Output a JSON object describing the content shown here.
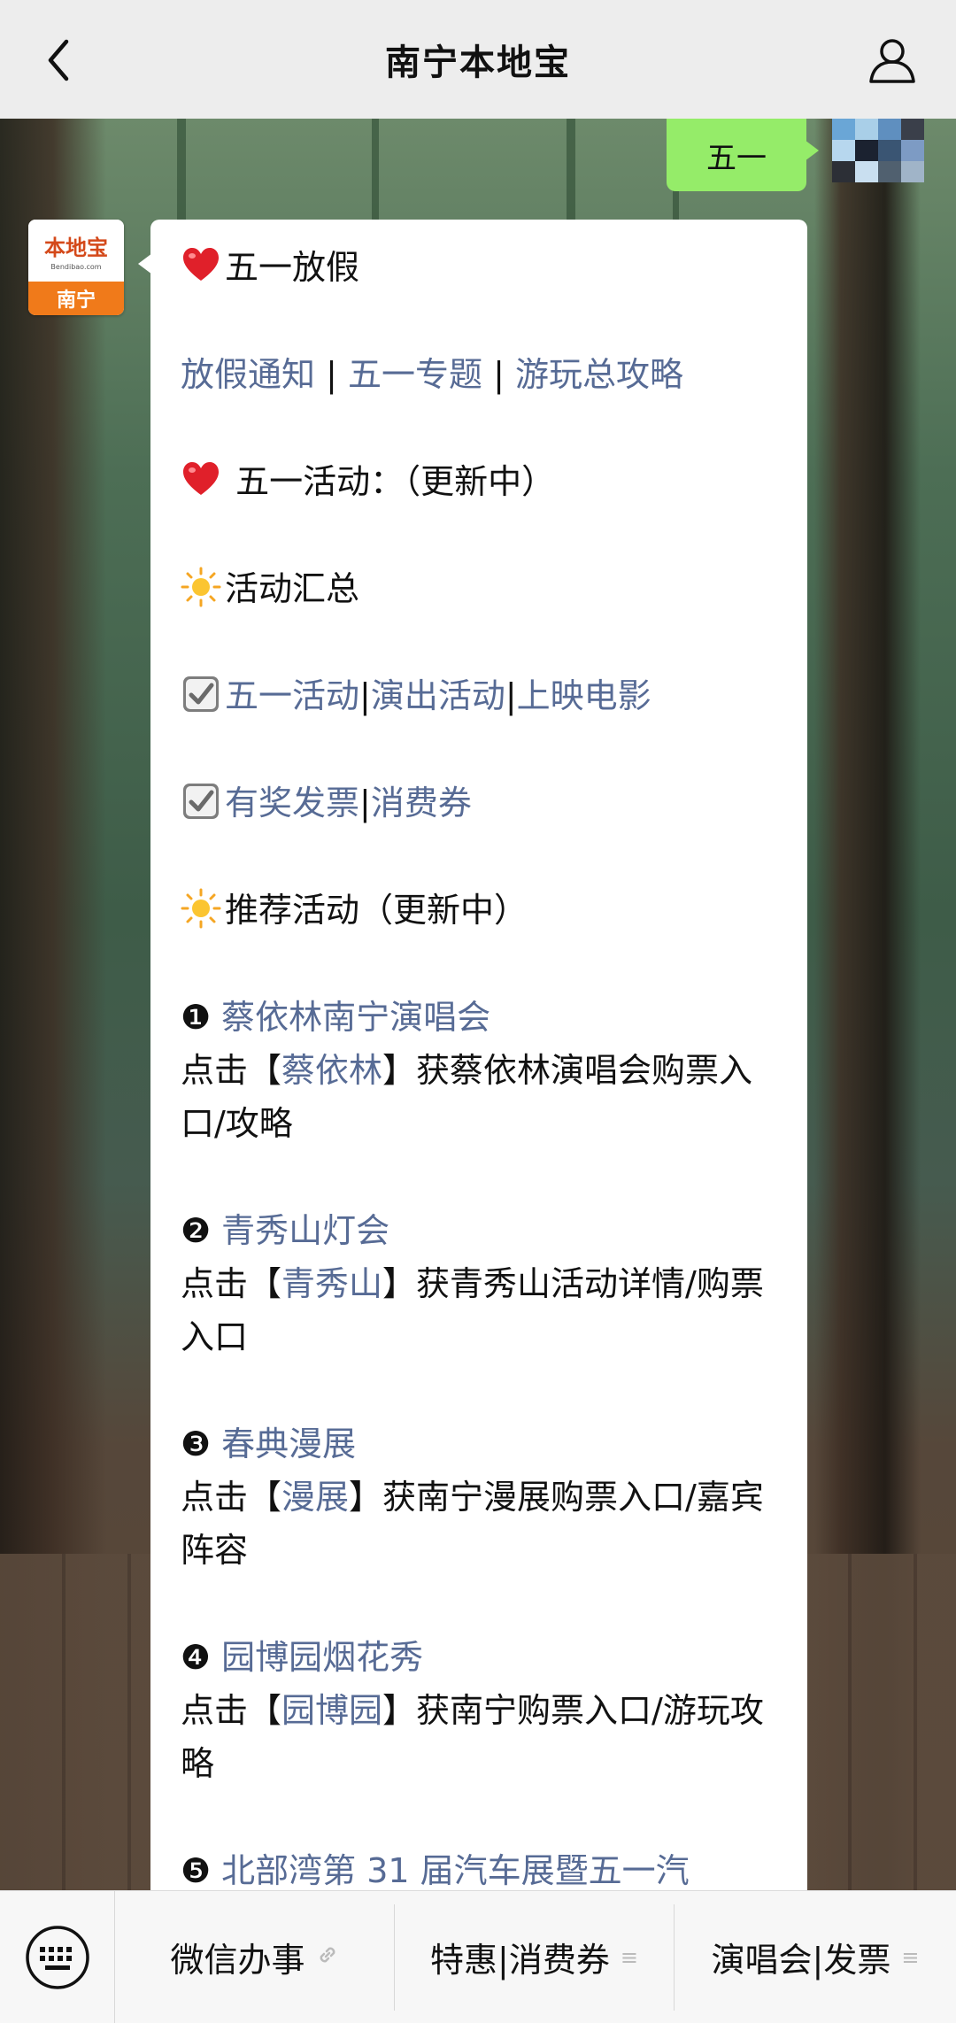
{
  "header": {
    "title": "南宁本地宝"
  },
  "outgoing": {
    "text": "五一"
  },
  "bot": {
    "logo_text": "本地宝",
    "logo_url": "Bendibao.com",
    "logo_city": "南宁"
  },
  "message": {
    "heading1": "五一放假",
    "links1": [
      "放假通知",
      "五一专题",
      "游玩总攻略"
    ],
    "heading2": " 五一活动：（更新中）",
    "section1": "活动汇总",
    "links2": [
      "五一活动",
      "演出活动",
      "上映电影"
    ],
    "links3": [
      "有奖发票",
      "消费券"
    ],
    "section2": "推荐活动（更新中）",
    "items": [
      {
        "num": "❶",
        "title": "蔡依林南宁演唱会",
        "pre": "点击【",
        "kw": "蔡依林",
        "post": "】获蔡依林演唱会购票入口/攻略"
      },
      {
        "num": "❷",
        "title": "青秀山灯会",
        "pre": "点击【",
        "kw": "青秀山",
        "post": "】获青秀山活动详情/购票入口"
      },
      {
        "num": "❸",
        "title": "春典漫展",
        "pre": "点击【",
        "kw": "漫展",
        "post": "】获南宁漫展购票入口/嘉宾阵容"
      },
      {
        "num": "❹",
        "title": "园博园烟花秀",
        "pre": "点击【",
        "kw": "园博园",
        "post": "】获南宁购票入口/游玩攻略"
      },
      {
        "num": "❺",
        "title": "北部湾第 31 届汽车展暨五一汽"
      }
    ],
    "separator": "|"
  },
  "bottom_menu": [
    {
      "label": "微信办事",
      "mark": "link"
    },
    {
      "label": "特惠|消费券",
      "mark": "≡"
    },
    {
      "label": "演唱会|发票",
      "mark": "≡"
    }
  ],
  "colors": {
    "link": "#576b95",
    "bubble_out": "#95ec69",
    "topbar": "#ededed"
  },
  "icons": [
    "back-arrow-icon",
    "profile-icon",
    "heart-icon",
    "sun-icon",
    "checkbox-icon",
    "keyboard-icon",
    "link-icon",
    "menu-lines-icon"
  ]
}
